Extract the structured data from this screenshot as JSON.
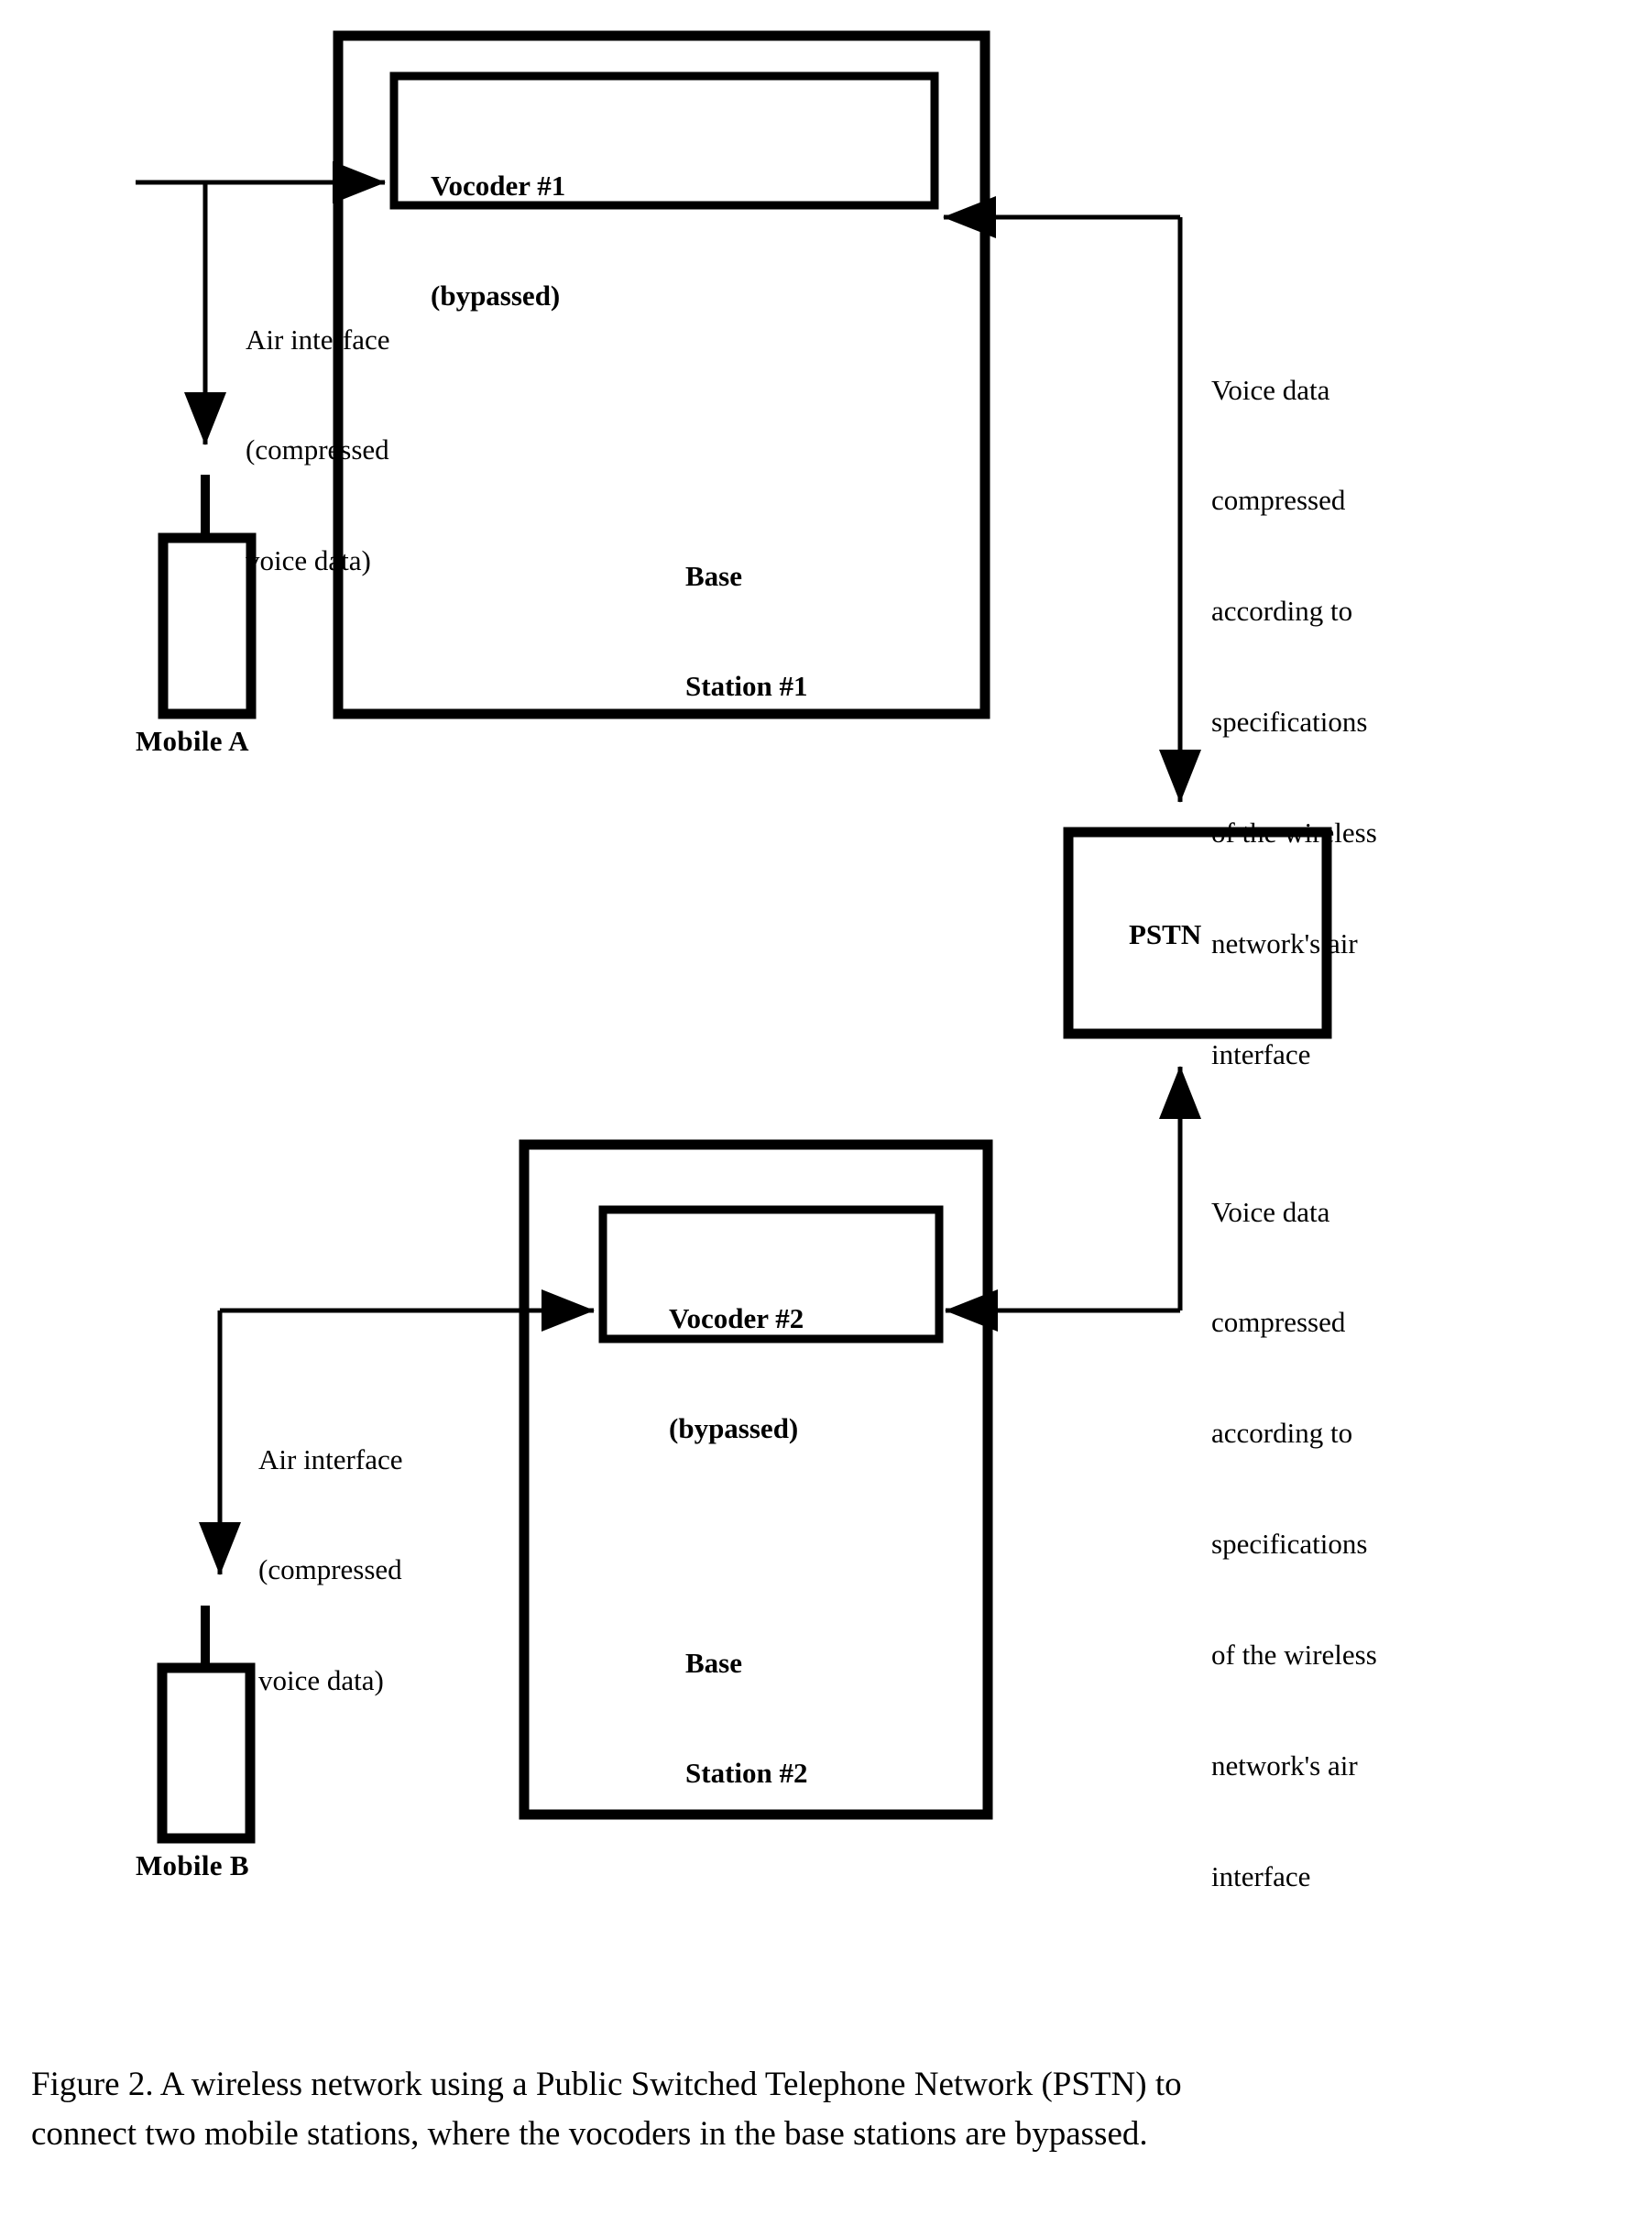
{
  "figure": {
    "caption_line_1": "Figure 2. A wireless network using a Public Switched Telephone Network (PSTN) to",
    "caption_line_2": "connect two mobile stations, where the vocoders in the base stations are bypassed."
  },
  "colors": {
    "stroke": "#000000",
    "background": "#ffffff"
  },
  "nodes": {
    "base_station_1": {
      "label_line_1": "Base",
      "label_line_2": "Station #1"
    },
    "vocoder_1": {
      "label_line_1": "Vocoder #1",
      "label_line_2": "(bypassed)"
    },
    "base_station_2": {
      "label_line_1": "Base",
      "label_line_2": "Station #2"
    },
    "vocoder_2": {
      "label_line_1": "Vocoder #2",
      "label_line_2": "(bypassed)"
    },
    "pstn": {
      "label": "PSTN"
    },
    "mobile_a": {
      "label": "Mobile A"
    },
    "mobile_b": {
      "label": "Mobile B"
    }
  },
  "annotations": {
    "air_interface_top": {
      "line_1": "Air interface",
      "line_2": "(compressed",
      "line_3": "voice data)"
    },
    "air_interface_bottom": {
      "line_1": "Air interface",
      "line_2": "(compressed",
      "line_3": "voice data)"
    },
    "voice_data_top": {
      "line_1": "Voice data",
      "line_2": "compressed",
      "line_3": "according to",
      "line_4": "specifications",
      "line_5": "of the wireless",
      "line_6": "network's air",
      "line_7": "interface"
    },
    "voice_data_bottom": {
      "line_1": "Voice data",
      "line_2": "compressed",
      "line_3": "according to",
      "line_4": "specifications",
      "line_5": "of the wireless",
      "line_6": "network's air",
      "line_7": "interface"
    }
  },
  "connectors": {
    "mobile_a_downlink": "arrow-down-to-mobile-a",
    "base1_uplink": "arrow-right-into-vocoder-1",
    "pstn_to_base1": "arrow-left-into-vocoder-1",
    "base1_to_pstn": "arrow-down-into-pstn",
    "pstn_to_base2": "arrow-left-into-vocoder-2",
    "base2_to_pstn": "arrow-up-into-pstn",
    "mobile_b_downlink": "arrow-down-to-mobile-b",
    "base2_uplink": "arrow-right-into-vocoder-2"
  }
}
